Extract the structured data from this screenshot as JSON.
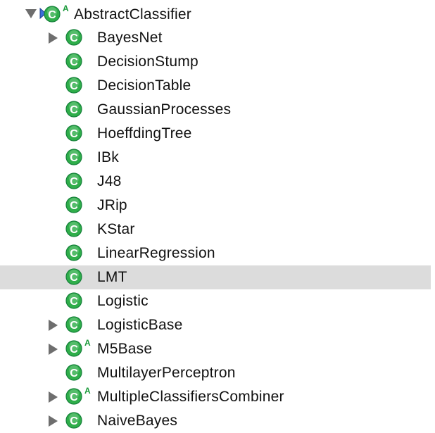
{
  "tree": {
    "root": {
      "label": "AbstractClassifier",
      "abstract_mark": "A",
      "expanded": true,
      "icon": "class-icon"
    },
    "children": [
      {
        "label": "BayesNet",
        "expandable": true,
        "abstract": false,
        "selected": false
      },
      {
        "label": "DecisionStump",
        "expandable": false,
        "abstract": false,
        "selected": false
      },
      {
        "label": "DecisionTable",
        "expandable": false,
        "abstract": false,
        "selected": false
      },
      {
        "label": "GaussianProcesses",
        "expandable": false,
        "abstract": false,
        "selected": false
      },
      {
        "label": "HoeffdingTree",
        "expandable": false,
        "abstract": false,
        "selected": false
      },
      {
        "label": "IBk",
        "expandable": false,
        "abstract": false,
        "selected": false
      },
      {
        "label": "J48",
        "expandable": false,
        "abstract": false,
        "selected": false
      },
      {
        "label": "JRip",
        "expandable": false,
        "abstract": false,
        "selected": false
      },
      {
        "label": "KStar",
        "expandable": false,
        "abstract": false,
        "selected": false
      },
      {
        "label": "LinearRegression",
        "expandable": false,
        "abstract": false,
        "selected": false
      },
      {
        "label": "LMT",
        "expandable": false,
        "abstract": false,
        "selected": true
      },
      {
        "label": "Logistic",
        "expandable": false,
        "abstract": false,
        "selected": false
      },
      {
        "label": "LogisticBase",
        "expandable": true,
        "abstract": false,
        "selected": false
      },
      {
        "label": "M5Base",
        "expandable": true,
        "abstract": true,
        "abstract_mark": "A",
        "selected": false
      },
      {
        "label": "MultilayerPerceptron",
        "expandable": false,
        "abstract": false,
        "selected": false
      },
      {
        "label": "MultipleClassifiersCombiner",
        "expandable": true,
        "abstract": true,
        "abstract_mark": "A",
        "selected": false
      },
      {
        "label": "NaiveBayes",
        "expandable": true,
        "abstract": false,
        "selected": false
      }
    ]
  },
  "colors": {
    "class_icon_fill": "#2fae4a",
    "class_icon_border": "#15803a",
    "selection_background": "#dcdcdc",
    "arrow": "#6e6e6e",
    "text": "#111111"
  }
}
